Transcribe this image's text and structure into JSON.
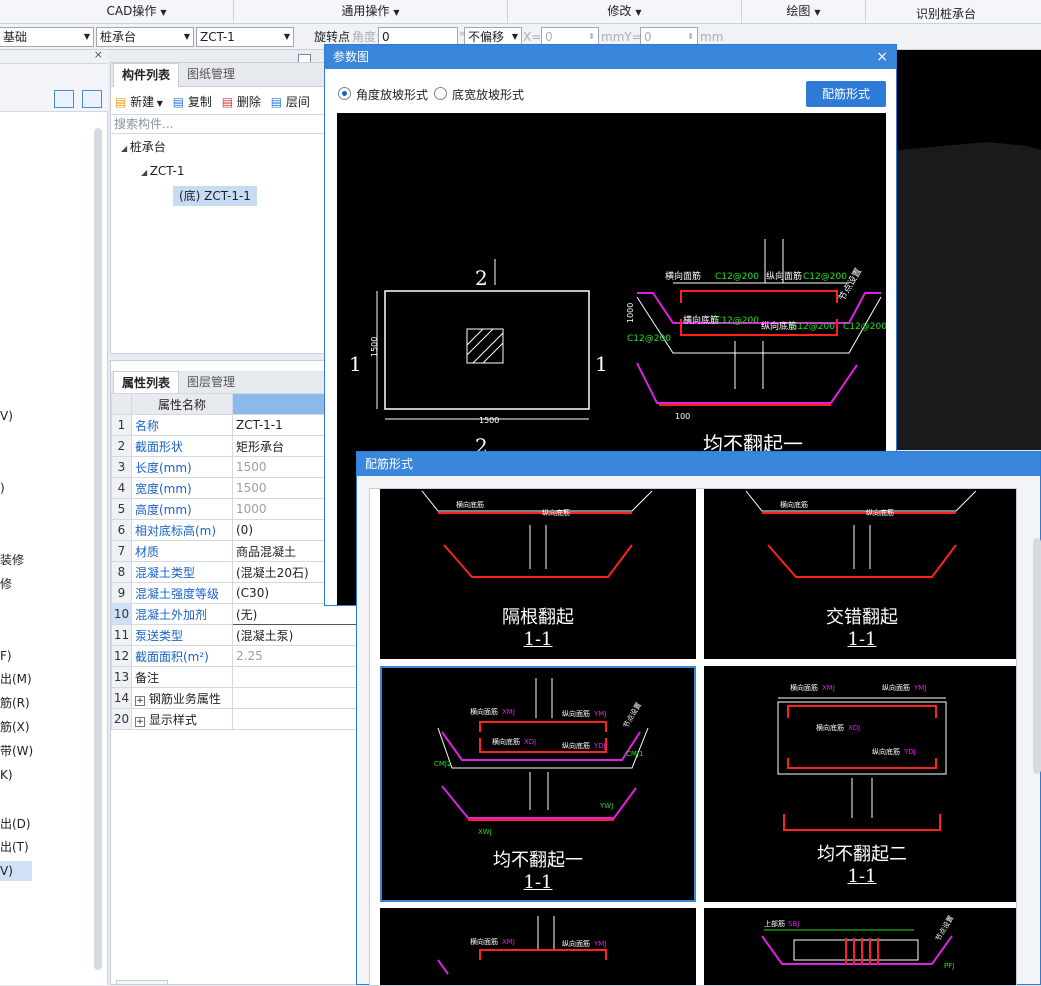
{
  "ribbon": {
    "groups": [
      "CAD操作",
      "通用操作",
      "修改",
      "绘图",
      "识别桩承台"
    ]
  },
  "toolbar": {
    "floor_select": "基础",
    "type_select": "桩承台",
    "component_select": "ZCT-1",
    "rotate_point_label": "旋转点",
    "angle_label": "角度:",
    "angle_value": "0",
    "degree_unit": "°",
    "offset_select": "不偏移",
    "x_label": "X=",
    "x_value": "0",
    "mm_y_label": "mmY=",
    "y_value": "0",
    "mm_unit": "mm"
  },
  "sidebar": {
    "items": [
      "V)",
      ")",
      "装修",
      "修",
      "F)",
      "出(M)",
      "筋(R)",
      "筋(X)",
      "带(W)",
      "K)",
      "出(D)",
      "出(T)",
      "V)"
    ]
  },
  "component_panel": {
    "tabs": [
      "构件列表",
      "图纸管理"
    ],
    "actions": {
      "new": "新建",
      "copy": "复制",
      "delete": "删除",
      "layer": "层间"
    },
    "search_placeholder": "搜索构件...",
    "tree": {
      "root": "桩承台",
      "child": "ZCT-1",
      "leaf": "(底) ZCT-1-1"
    }
  },
  "property_panel": {
    "tabs": [
      "属性列表",
      "图层管理"
    ],
    "header": {
      "name_col": "属性名称",
      "value_col": ""
    },
    "rows": [
      {
        "no": "1",
        "name": "名称",
        "value": "ZCT-1-1"
      },
      {
        "no": "2",
        "name": "截面形状",
        "value": "矩形承台"
      },
      {
        "no": "3",
        "name": "长度(mm)",
        "value": "1500"
      },
      {
        "no": "4",
        "name": "宽度(mm)",
        "value": "1500"
      },
      {
        "no": "5",
        "name": "高度(mm)",
        "value": "1000"
      },
      {
        "no": "6",
        "name": "相对底标高(m)",
        "value": "(0)"
      },
      {
        "no": "7",
        "name": "材质",
        "value": "商品混凝土"
      },
      {
        "no": "8",
        "name": "混凝土类型",
        "value": "(混凝土20石)"
      },
      {
        "no": "9",
        "name": "混凝土强度等级",
        "value": "(C30)"
      },
      {
        "no": "10",
        "name": "混凝土外加剂",
        "value": "(无)"
      },
      {
        "no": "11",
        "name": "泵送类型",
        "value": "(混凝土泵)"
      },
      {
        "no": "12",
        "name": "截面面积(m²)",
        "value": "2.25"
      },
      {
        "no": "13",
        "name": "备注",
        "value": ""
      },
      {
        "no": "14",
        "name": "钢筋业务属性",
        "value": ""
      },
      {
        "no": "20",
        "name": "显示样式",
        "value": ""
      }
    ]
  },
  "param_dialog": {
    "title": "参数图",
    "close": "×",
    "radio_angle": "角度放坡形式",
    "radio_width": "底宽放坡形式",
    "rebar_button": "配筋形式",
    "drawing": {
      "section_mark": "2",
      "side_mark": "1",
      "dim_width": "1500",
      "dim_height": "1500",
      "dim_depth": "1000",
      "dim_100": "100",
      "label_top_h": "横向面筋",
      "label_top_v": "纵向面筋",
      "label_bot_h": "横向底筋",
      "label_bot_v": "纵向底筋",
      "rebar_spec": "C12@200",
      "side_label": "节点设置",
      "caption": "均不翻起一"
    }
  },
  "rebar_dialog": {
    "title": "配筋形式",
    "cards": [
      {
        "caption": "隔根翻起",
        "section": "1-1"
      },
      {
        "caption": "交错翻起",
        "section": "1-1"
      },
      {
        "caption": "均不翻起一",
        "section": "1-1"
      },
      {
        "caption": "均不翻起二",
        "section": "1-1"
      }
    ],
    "labels": {
      "top_h": "横向面筋",
      "top_v": "纵向面筋",
      "bot_h": "横向底筋",
      "bot_v": "纵向底筋",
      "xmj": "XMJ",
      "ymj": "YMJ",
      "xdj": "XDJ",
      "ydj": "YDJ",
      "cmj": "CMJ",
      "cmj1": "CMJ1",
      "cmj2": "CMJ2",
      "xwj": "XWJ",
      "ywj": "YWJ",
      "node": "节点设置",
      "top_bar": "上部筋",
      "sbj": "SBJ",
      "pfj": "PFJ"
    }
  },
  "colors": {
    "accent": "#3a86da",
    "rebar_red": "#ff2020",
    "rebar_magenta": "#e020e0",
    "dim_green": "#20e020"
  }
}
